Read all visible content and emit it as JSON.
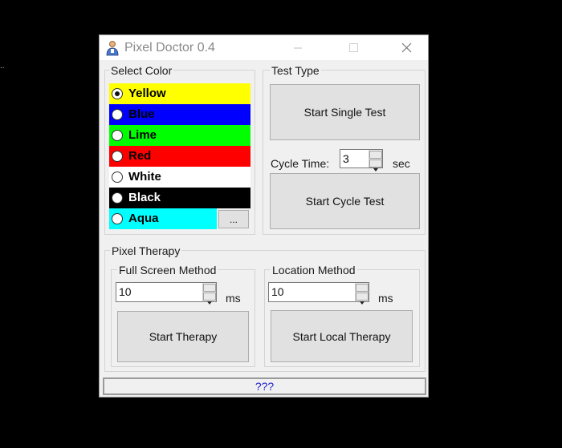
{
  "window": {
    "title": "Pixel Doctor 0.4"
  },
  "stray_text": "..",
  "select_color": {
    "title": "Select Color",
    "colors": [
      {
        "label": "Yellow",
        "bg": "#ffff00",
        "text": "#000000",
        "selected": true
      },
      {
        "label": "Blue",
        "bg": "#0000ff",
        "text": "#000000",
        "selected": false
      },
      {
        "label": "Lime",
        "bg": "#00ff00",
        "text": "#000000",
        "selected": false
      },
      {
        "label": "Red",
        "bg": "#ff0000",
        "text": "#000000",
        "selected": false
      },
      {
        "label": "White",
        "bg": "#ffffff",
        "text": "#000000",
        "selected": false
      },
      {
        "label": "Black",
        "bg": "#000000",
        "text": "#ffffff",
        "selected": false
      },
      {
        "label": "Aqua",
        "bg": "#00ffff",
        "text": "#000000",
        "selected": false
      }
    ],
    "more_button": "..."
  },
  "test_type": {
    "title": "Test Type",
    "single_button": "Start Single Test",
    "cycle_label": "Cycle Time:",
    "cycle_value": "3",
    "cycle_unit": "sec",
    "cycle_button": "Start Cycle Test"
  },
  "pixel_therapy": {
    "title": "Pixel Therapy",
    "full_screen": {
      "title": "Full Screen Method",
      "value": "10",
      "unit": "ms",
      "button": "Start Therapy"
    },
    "location": {
      "title": "Location Method",
      "value": "10",
      "unit": "ms",
      "button": "Start Local Therapy"
    }
  },
  "status": {
    "text": "???",
    "color": "#1f1fcf"
  },
  "icons": {
    "app": "person-icon",
    "minimize": "minimize-icon",
    "maximize": "maximize-icon",
    "close": "close-icon"
  }
}
